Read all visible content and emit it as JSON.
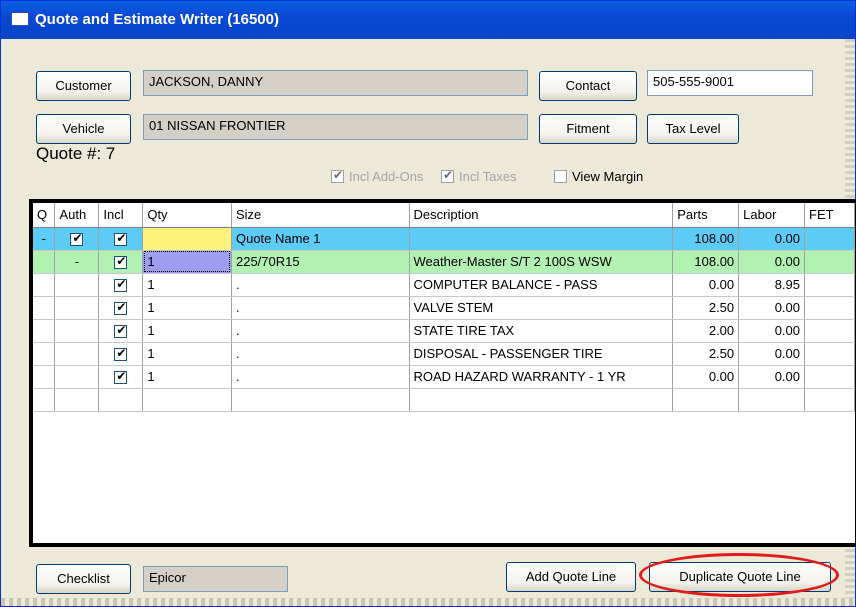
{
  "window": {
    "title": "Quote and Estimate Writer (16500)"
  },
  "customer": {
    "button": "Customer",
    "value": "JACKSON, DANNY"
  },
  "vehicle": {
    "button": "Vehicle",
    "value": "01 NISSAN FRONTIER"
  },
  "contact": {
    "button": "Contact",
    "value": "505-555-9001"
  },
  "fitment": {
    "button": "Fitment"
  },
  "tax_level": {
    "button": "Tax Level"
  },
  "quote": {
    "label": "Quote #: 7"
  },
  "options": {
    "incl_addons": "Incl Add-Ons",
    "incl_taxes": "Incl Taxes",
    "view_margin": "View Margin"
  },
  "grid": {
    "headers": [
      "Q",
      "Auth",
      "Incl",
      "Qty",
      "Size",
      "Description",
      "Parts",
      "Labor",
      "FET"
    ],
    "rows": [
      {
        "q": "-",
        "auth": true,
        "incl": true,
        "qty": "",
        "size": "Quote Name 1",
        "description": "",
        "parts": "108.00",
        "labor": "0.00"
      },
      {
        "q": "",
        "auth": "-",
        "incl": true,
        "qty": "1",
        "size": "225/70R15",
        "description": "Weather-Master S/T 2 100S WSW",
        "parts": "108.00",
        "labor": "0.00"
      },
      {
        "q": "",
        "auth": "",
        "incl": true,
        "qty": "1",
        "size": ".",
        "description": "COMPUTER BALANCE - PASS",
        "parts": "0.00",
        "labor": "8.95"
      },
      {
        "q": "",
        "auth": "",
        "incl": true,
        "qty": "1",
        "size": ".",
        "description": "VALVE STEM",
        "parts": "2.50",
        "labor": "0.00"
      },
      {
        "q": "",
        "auth": "",
        "incl": true,
        "qty": "1",
        "size": ".",
        "description": "STATE TIRE TAX",
        "parts": "2.00",
        "labor": "0.00"
      },
      {
        "q": "",
        "auth": "",
        "incl": true,
        "qty": "1",
        "size": ".",
        "description": "DISPOSAL - PASSENGER TIRE",
        "parts": "2.50",
        "labor": "0.00"
      },
      {
        "q": "",
        "auth": "",
        "incl": true,
        "qty": "1",
        "size": ".",
        "description": "ROAD HAZARD WARRANTY - 1 YR",
        "parts": "0.00",
        "labor": "0.00"
      }
    ]
  },
  "checklist": {
    "button": "Checklist",
    "value": "Epicor"
  },
  "actions": {
    "add_quote_line": "Add Quote Line",
    "duplicate_quote_line": "Duplicate Quote Line"
  },
  "colors": {
    "quote_row": "#5ccbf6",
    "tire_row": "#b1f1b1",
    "qty_highlight": "#fff37d",
    "selected_cell": "#9e9df1",
    "annotation": "#e01b1b"
  }
}
